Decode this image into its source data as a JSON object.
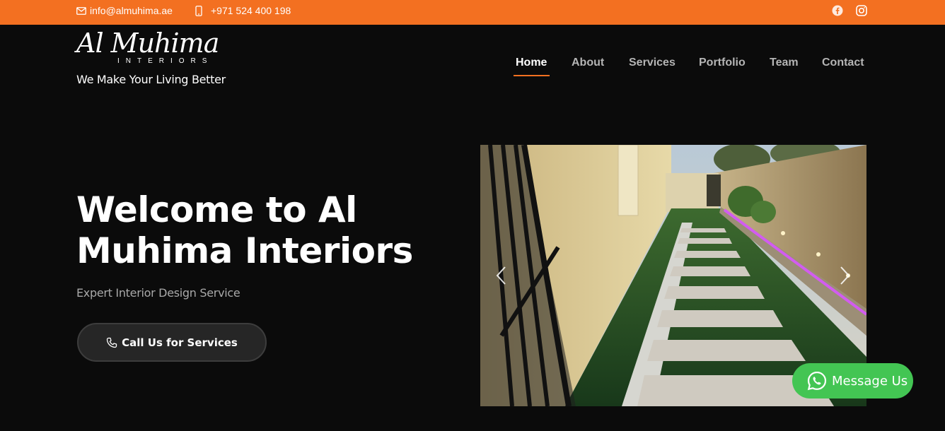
{
  "topbar": {
    "email": "info@almuhima.ae",
    "phone": "+971 524 400 198",
    "background_color": "#f37021",
    "icons": [
      "envelope-icon",
      "mobile-phone-icon",
      "facebook-icon",
      "instagram-icon"
    ]
  },
  "header": {
    "logo_script": "Al Muhima",
    "logo_sub": "INTERIORS",
    "tagline": "We Make Your Living Better"
  },
  "nav": {
    "items": [
      {
        "label": "Home",
        "active": true
      },
      {
        "label": "About",
        "active": false
      },
      {
        "label": "Services",
        "active": false
      },
      {
        "label": "Portfolio",
        "active": false
      },
      {
        "label": "Team",
        "active": false
      },
      {
        "label": "Contact",
        "active": false
      }
    ],
    "accent_color": "#f37021"
  },
  "hero": {
    "title": "Welcome to Al Muhima Interiors",
    "subtitle": "Expert Interior Design Service",
    "cta_label": "Call Us for Services",
    "cta_icon": "phone-icon"
  },
  "slider": {
    "image": "garden-walkway-photo",
    "controls": [
      "chevron-left-icon",
      "chevron-right-icon"
    ]
  },
  "whatsapp": {
    "label": "Message Us",
    "icon": "whatsapp-icon",
    "color": "#43c553"
  }
}
